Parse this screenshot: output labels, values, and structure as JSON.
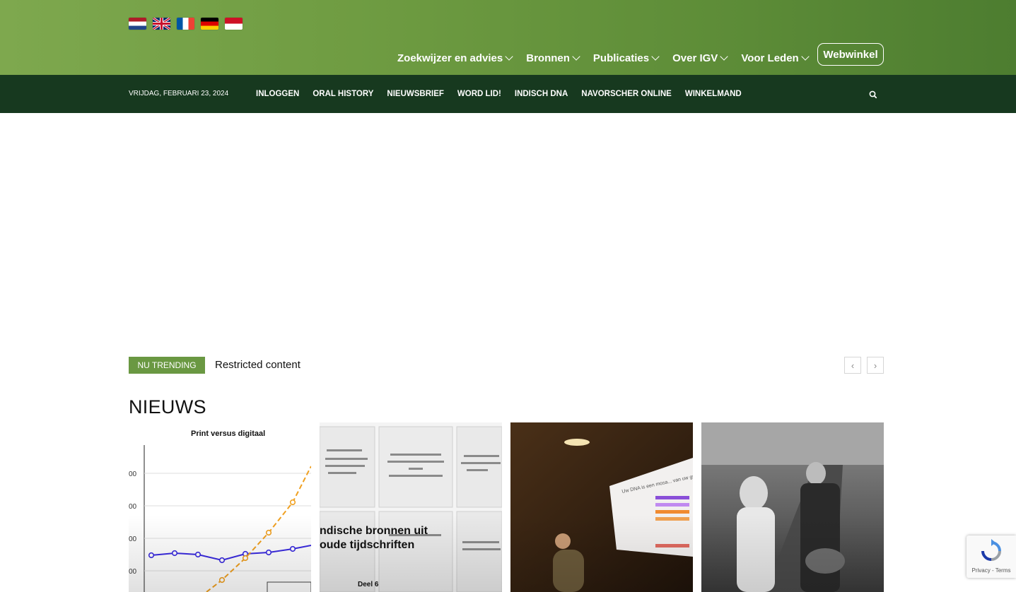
{
  "header": {
    "languages": [
      "Nederlands",
      "English",
      "Français",
      "Deutsch",
      "Bahasa Indonesia"
    ],
    "nav": [
      {
        "label": "Zoekwijzer en advies"
      },
      {
        "label": "Bronnen"
      },
      {
        "label": "Publicaties"
      },
      {
        "label": "Over IGV"
      },
      {
        "label": "Voor Leden"
      }
    ],
    "webwinkel_label": "Webwinkel",
    "brand_green": "#6f9c42"
  },
  "topbar": {
    "date": "VRIJDAG, FEBRUARI 23, 2024",
    "links": [
      "INLOGGEN",
      "ORAL HISTORY",
      "NIEUWSBRIEF",
      "WORD LID!",
      "INDISCH DNA",
      "NAVORSCHER ONLINE",
      "WINKELMAND"
    ],
    "search_icon": "search-icon",
    "bar_color": "#17391f"
  },
  "trending": {
    "badge": "NU TRENDING",
    "item": "Restricted content",
    "prev": "‹",
    "next": "›"
  },
  "news": {
    "title": "NIEUWS",
    "cards": [
      {
        "chart_title": "Print versus digitaal"
      },
      {
        "caption_line1": "ndische bronnen uit",
        "caption_line2": "oude tijdschriften",
        "label": "Deel 6"
      },
      {
        "slide_text": "Uw DNA is een mosa... van uw grootouders"
      },
      {}
    ]
  },
  "recaptcha": {
    "links": "Privacy - Terms"
  }
}
